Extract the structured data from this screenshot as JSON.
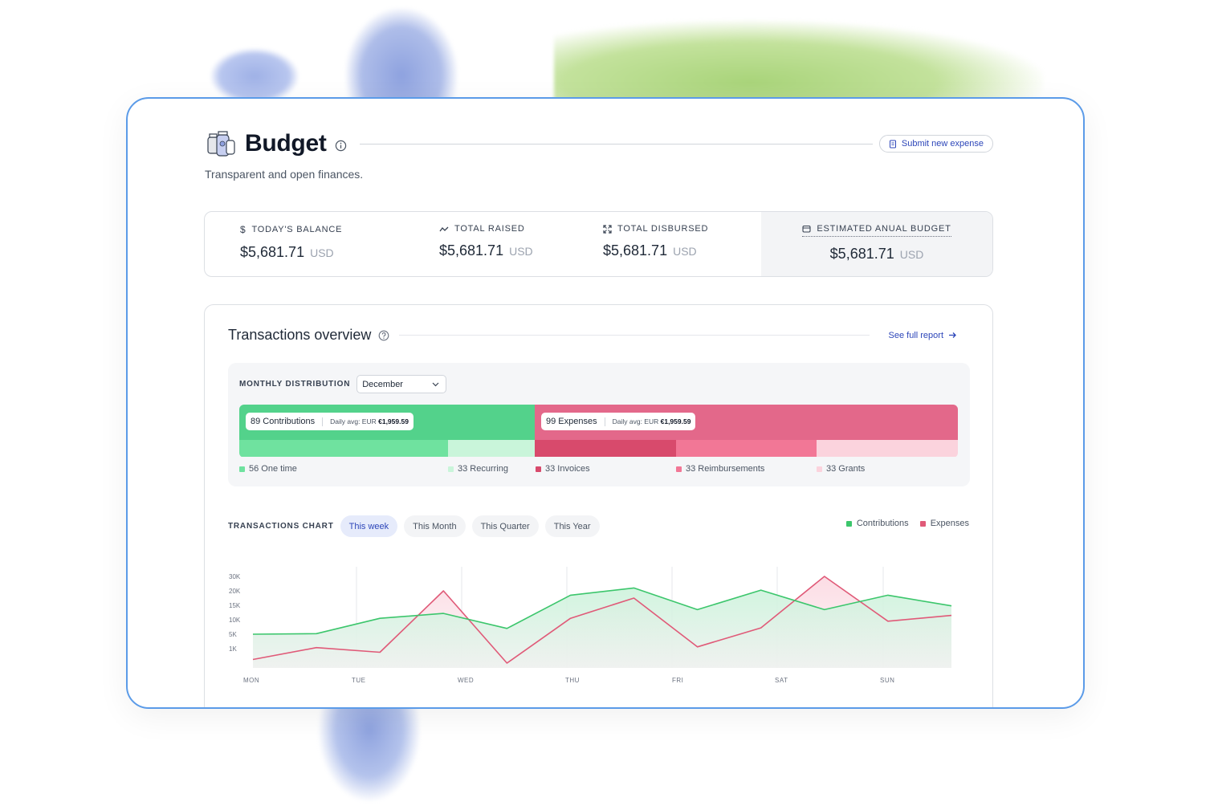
{
  "header": {
    "title": "Budget",
    "subtitle": "Transparent and open finances.",
    "submit_label": "Submit new expense"
  },
  "stats": [
    {
      "icon": "dollar-icon",
      "label": "TODAY'S BALANCE",
      "value": "$5,681.71",
      "currency": "USD"
    },
    {
      "icon": "trend-icon",
      "label": "TOTAL RAISED",
      "value": "$5,681.71",
      "currency": "USD"
    },
    {
      "icon": "expand-icon",
      "label": "TOTAL DISBURSED",
      "value": "$5,681.71",
      "currency": "USD"
    },
    {
      "icon": "calendar-icon",
      "label": "ESTIMATED ANUAL BUDGET",
      "value": "$5,681.71",
      "currency": "USD"
    }
  ],
  "overview": {
    "title": "Transactions overview",
    "report_link": "See full report",
    "distribution": {
      "label": "MONTHLY DISTRIBUTION",
      "month": "December",
      "contributions": {
        "label": "89 Contributions",
        "avg": "Daily avg: EUR ",
        "avg_value": "€1,959.59",
        "count": 89
      },
      "expenses": {
        "label": "99 Expenses",
        "avg": "Daily avg: EUR ",
        "avg_value": "€1,959.59",
        "count": 99
      },
      "legend": [
        {
          "label": "56 One time",
          "color": "#6fe29f",
          "count": 56
        },
        {
          "label": "33 Recurring",
          "color": "#c9f5da",
          "count": 33
        },
        {
          "label": "33 Invoices",
          "color": "#d84a6c",
          "count": 33
        },
        {
          "label": "33 Reimbursements",
          "color": "#f27796",
          "count": 33
        },
        {
          "label": "33 Grants",
          "color": "#fbd3dd",
          "count": 33
        }
      ]
    },
    "chart_header": {
      "label": "TRANSACTIONS CHART",
      "tabs": [
        "This week",
        "This Month",
        "This Quarter",
        "This Year"
      ],
      "active_tab": "This week",
      "legend": [
        {
          "label": "Contributions",
          "color": "#3cc66c"
        },
        {
          "label": "Expenses",
          "color": "#e05a78"
        }
      ]
    }
  },
  "chart_data": {
    "type": "line",
    "x": [
      "MON",
      "",
      "TUE",
      "",
      "WED",
      "",
      "THU",
      "",
      "FRI",
      "",
      "SAT",
      "",
      "SUN",
      ""
    ],
    "x_tick_labels": [
      "MON",
      "TUE",
      "WED",
      "THU",
      "FRI",
      "SAT",
      "SUN"
    ],
    "y_tick_labels": [
      "30K",
      "20K",
      "15K",
      "10K",
      "5K",
      "1K"
    ],
    "y_tick_values": [
      30,
      20,
      15,
      10,
      5,
      1
    ],
    "series": [
      {
        "name": "Contributions",
        "color": "#3cc66c",
        "values": [
          5,
          5.2,
          10.5,
          12.2,
          7,
          18.5,
          22,
          13.5,
          20.5,
          13.5,
          18.5,
          14.8
        ]
      },
      {
        "name": "Expenses",
        "color": "#e05a78",
        "values": [
          -2,
          1.3,
          0,
          20,
          -3,
          10.5,
          17.5,
          1.5,
          7.2,
          30,
          9.5,
          11.5
        ]
      }
    ],
    "grid": true
  },
  "colors": {
    "accent": "#2d46b9",
    "contributions": "#53d28b",
    "expenses": "#e3688a"
  }
}
